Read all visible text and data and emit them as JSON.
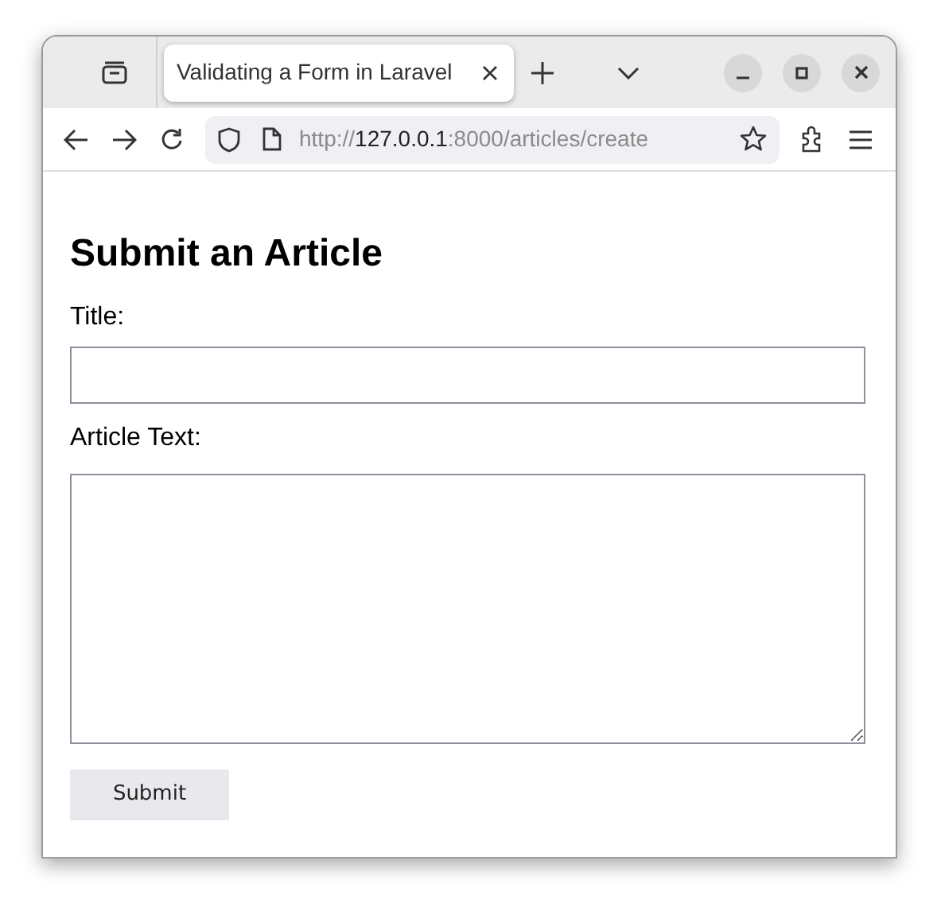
{
  "browser": {
    "tab": {
      "title": "Validating a Form in Laravel",
      "selected": true
    },
    "url": {
      "scheme": "http://",
      "host": "127.0.0.1",
      "rest": ":8000/articles/create"
    }
  },
  "page": {
    "heading": "Submit an Article",
    "fields": [
      {
        "kind": "input",
        "label": "Title:"
      },
      {
        "kind": "textarea",
        "label": "Article Text:"
      }
    ],
    "submit": "Submit"
  }
}
